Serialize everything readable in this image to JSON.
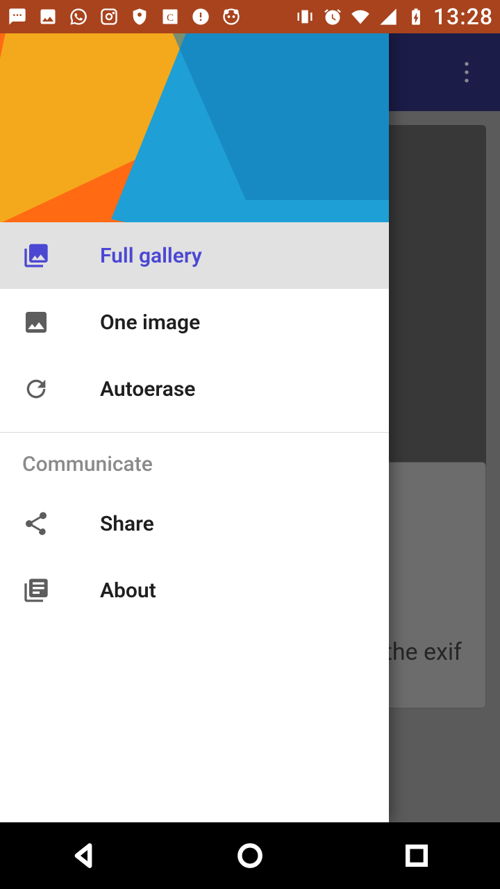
{
  "status": {
    "time": "13:28"
  },
  "drawer": {
    "items": [
      {
        "label": "Full gallery"
      },
      {
        "label": "One image"
      },
      {
        "label": "Autoerase"
      }
    ],
    "section_label": "Communicate",
    "section_items": [
      {
        "label": "Share"
      },
      {
        "label": "About"
      }
    ]
  },
  "background": {
    "peek_text": "the exif"
  },
  "colors": {
    "drawer_accent": "#4b47d3",
    "appbar": "#2a2d6f",
    "statusbar": "#a8431d"
  }
}
